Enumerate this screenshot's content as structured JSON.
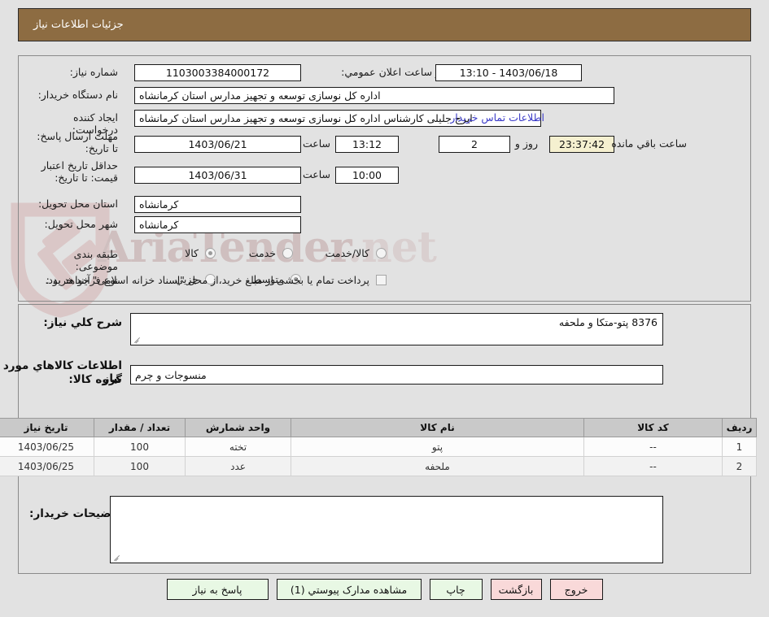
{
  "header": {
    "title": "جزئیات اطلاعات نیاز"
  },
  "form": {
    "need_number_label": "شماره نیاز:",
    "need_number_value": "1103003384000172",
    "public_announce_label": "تاریخ و ساعت اعلان عمومي:",
    "public_announce_value": "1403/06/18 - 13:10",
    "buyer_org_label": "نام دستگاه خریدار:",
    "buyer_org_value": "اداره کل نوسازی  توسعه و تجهیز مدارس استان کرمانشاه",
    "requester_label": "ایجاد کننده درخواست:",
    "requester_value": "ایرج جلیلی کارشناس اداره کل نوسازی  توسعه و تجهیز مدارس استان کرمانشاه",
    "contact_link": "اطلاعات تماس خریدار",
    "reply_deadline_label": "مهلت ارسال پاسخ: تا تاریخ:",
    "reply_deadline_date": "1403/06/21",
    "reply_deadline_time_label": "ساعت",
    "reply_deadline_time": "13:12",
    "remaining_days": "2",
    "remaining_days_label": "روز و",
    "remaining_clock": "23:37:42",
    "remaining_suffix": "ساعت باقي مانده",
    "price_validity_label": "حداقل تاریخ اعتبار قیمت: تا تاریخ:",
    "price_validity_date": "1403/06/31",
    "price_validity_time_label": "ساعت",
    "price_validity_time": "10:00",
    "delivery_province_label": "استان محل تحویل:",
    "delivery_province_value": "کرمانشاه",
    "delivery_city_label": "شهر محل تحویل:",
    "delivery_city_value": "کرمانشاه",
    "subject_class_label": "طبقه بندی موضوعی:",
    "subject_options": [
      {
        "label": "کالا",
        "selected": true
      },
      {
        "label": "خدمت",
        "selected": false
      },
      {
        "label": "کالا/خدمت",
        "selected": false
      }
    ],
    "process_type_label": "نوع فرآیند خرید :",
    "process_options": [
      {
        "label": "جزیي",
        "selected": false
      },
      {
        "label": "متوسط",
        "selected": true
      }
    ],
    "treasury_checkbox_checked": false,
    "treasury_note": "پرداخت تمام یا بخشی از مبلغ خرید،از محل \"اسناد خزانه اسلامی\" خواهد بود."
  },
  "details": {
    "general_desc_label": "شرح کلي نیاز:",
    "general_desc_value": "8376 پتو-متکا و ملحفه",
    "goods_info_heading": "اطلاعات کالاهاي مورد نیاز",
    "goods_group_label": "گروه کالا:",
    "goods_group_value": "منسوجات و چرم",
    "buyer_notes_label": "توضیحات خریدار:",
    "buyer_notes_value": ""
  },
  "table": {
    "columns": [
      "ردیف",
      "کد کالا",
      "نام کالا",
      "واحد شمارش",
      "تعداد / مقدار",
      "تاریخ نیاز"
    ],
    "rows": [
      {
        "index": "1",
        "code": "--",
        "name": "پتو",
        "unit": "تخته",
        "qty": "100",
        "date": "1403/06/25"
      },
      {
        "index": "2",
        "code": "--",
        "name": "ملحفه",
        "unit": "عدد",
        "qty": "100",
        "date": "1403/06/25"
      }
    ]
  },
  "buttons": {
    "respond": "پاسخ به نیاز",
    "attachments": "مشاهده مدارک پیوستي (1)",
    "print": "چاپ",
    "back": "بازگشت",
    "exit": "خروج"
  },
  "watermark": {
    "primary": "AriaTender",
    "secondary": ".net"
  },
  "colors": {
    "header_bg": "#8d6c42",
    "button_green": "#e8f8e4",
    "button_pink": "#f9d9d9",
    "countdown_bg": "#f5f0d0",
    "link": "#3b3bc8"
  }
}
